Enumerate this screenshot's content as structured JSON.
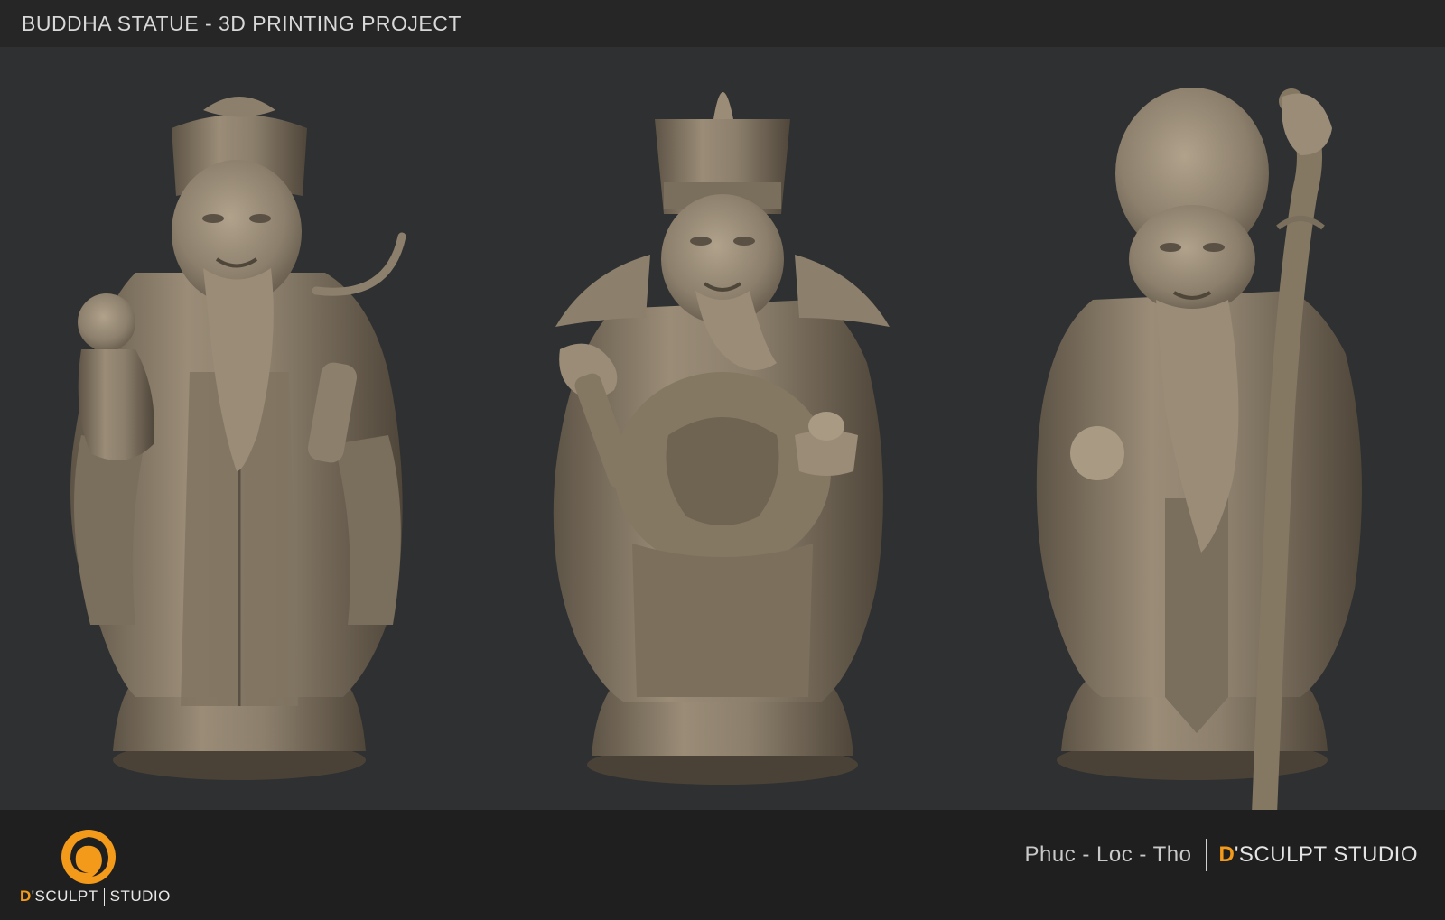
{
  "header": {
    "title": "BUDDHA STATUE - 3D PRINTING PROJECT"
  },
  "footer": {
    "logo_d": "D",
    "logo_sculpt": "'SCULPT",
    "logo_studio": "STUDIO",
    "subtitle": "Phuc - Loc - Tho",
    "studio_d": "D",
    "studio_name": "'SCULPT STUDIO"
  },
  "colors": {
    "background": "#2f3032",
    "header": "#262627",
    "footer": "#1f1f20",
    "accent": "#f39a1a",
    "statue": "#8c7f6c"
  }
}
